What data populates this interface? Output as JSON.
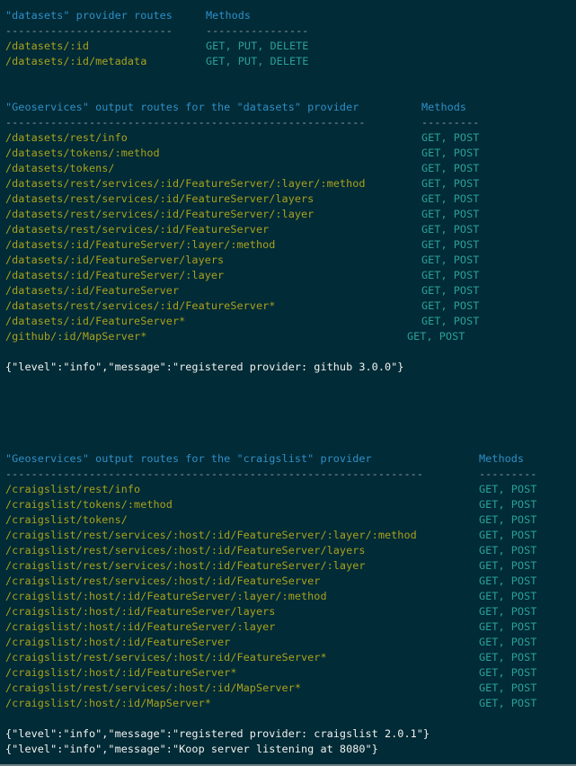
{
  "sections": {
    "datasets_provider": {
      "header_left": "\"datasets\" provider routes",
      "header_right": "Methods",
      "divider_left": "--------------------------",
      "divider_right": "----------------",
      "rows": [
        {
          "route": "/datasets/:id",
          "methods": "GET, PUT, DELETE"
        },
        {
          "route": "/datasets/:id/metadata",
          "methods": "GET, PUT, DELETE"
        }
      ]
    },
    "datasets_geoservices": {
      "header_left": "\"Geoservices\" output routes for the \"datasets\" provider",
      "header_right": "Methods",
      "divider_left": "--------------------------------------------------------",
      "divider_right": "---------",
      "rows": [
        {
          "route": "/datasets/rest/info",
          "methods": "GET, POST"
        },
        {
          "route": "/datasets/tokens/:method",
          "methods": "GET, POST"
        },
        {
          "route": "/datasets/tokens/",
          "methods": "GET, POST"
        },
        {
          "route": "/datasets/rest/services/:id/FeatureServer/:layer/:method",
          "methods": "GET, POST"
        },
        {
          "route": "/datasets/rest/services/:id/FeatureServer/layers",
          "methods": "GET, POST"
        },
        {
          "route": "/datasets/rest/services/:id/FeatureServer/:layer",
          "methods": "GET, POST"
        },
        {
          "route": "/datasets/rest/services/:id/FeatureServer",
          "methods": "GET, POST"
        },
        {
          "route": "/datasets/:id/FeatureServer/:layer/:method",
          "methods": "GET, POST"
        },
        {
          "route": "/datasets/:id/FeatureServer/layers",
          "methods": "GET, POST"
        },
        {
          "route": "/datasets/:id/FeatureServer/:layer",
          "methods": "GET, POST"
        },
        {
          "route": "/datasets/:id/FeatureServer",
          "methods": "GET, POST"
        },
        {
          "route": "/datasets/rest/services/:id/FeatureServer*",
          "methods": "GET, POST"
        },
        {
          "route": "/datasets/:id/FeatureServer*",
          "methods": "GET, POST"
        },
        {
          "route": "/github/:id/MapServer*",
          "methods": "GET, POST"
        }
      ]
    },
    "craigslist_geoservices": {
      "header_left": "\"Geoservices\" output routes for the \"craigslist\" provider",
      "header_right": "Methods",
      "divider_left": "-----------------------------------------------------------------",
      "divider_right": "---------",
      "rows": [
        {
          "route": "/craigslist/rest/info",
          "methods": "GET, POST"
        },
        {
          "route": "/craigslist/tokens/:method",
          "methods": "GET, POST"
        },
        {
          "route": "/craigslist/tokens/",
          "methods": "GET, POST"
        },
        {
          "route": "/craigslist/rest/services/:host/:id/FeatureServer/:layer/:method",
          "methods": "GET, POST"
        },
        {
          "route": "/craigslist/rest/services/:host/:id/FeatureServer/layers",
          "methods": "GET, POST"
        },
        {
          "route": "/craigslist/rest/services/:host/:id/FeatureServer/:layer",
          "methods": "GET, POST"
        },
        {
          "route": "/craigslist/rest/services/:host/:id/FeatureServer",
          "methods": "GET, POST"
        },
        {
          "route": "/craigslist/:host/:id/FeatureServer/:layer/:method",
          "methods": "GET, POST"
        },
        {
          "route": "/craigslist/:host/:id/FeatureServer/layers",
          "methods": "GET, POST"
        },
        {
          "route": "/craigslist/:host/:id/FeatureServer/:layer",
          "methods": "GET, POST"
        },
        {
          "route": "/craigslist/:host/:id/FeatureServer",
          "methods": "GET, POST"
        },
        {
          "route": "/craigslist/rest/services/:host/:id/FeatureServer*",
          "methods": "GET, POST"
        },
        {
          "route": "/craigslist/:host/:id/FeatureServer*",
          "methods": "GET, POST"
        },
        {
          "route": "/craigslist/rest/services/:host/:id/MapServer*",
          "methods": "GET, POST"
        },
        {
          "route": "/craigslist/:host/:id/MapServer*",
          "methods": "GET, POST"
        }
      ]
    }
  },
  "logs": {
    "github_registered": "{\"level\":\"info\",\"message\":\"registered provider: github 3.0.0\"}",
    "craigslist_registered": "{\"level\":\"info\",\"message\":\"registered provider: craigslist 2.0.1\"}",
    "listening": "{\"level\":\"info\",\"message\":\"Koop server listening at 8080\"}"
  },
  "colors": {
    "background": "#012b36",
    "header": "#2f8fc8",
    "divider": "#8a9aa2",
    "route": "#a9a11d",
    "methods": "#2aa198",
    "log": "#f2f2f2"
  }
}
